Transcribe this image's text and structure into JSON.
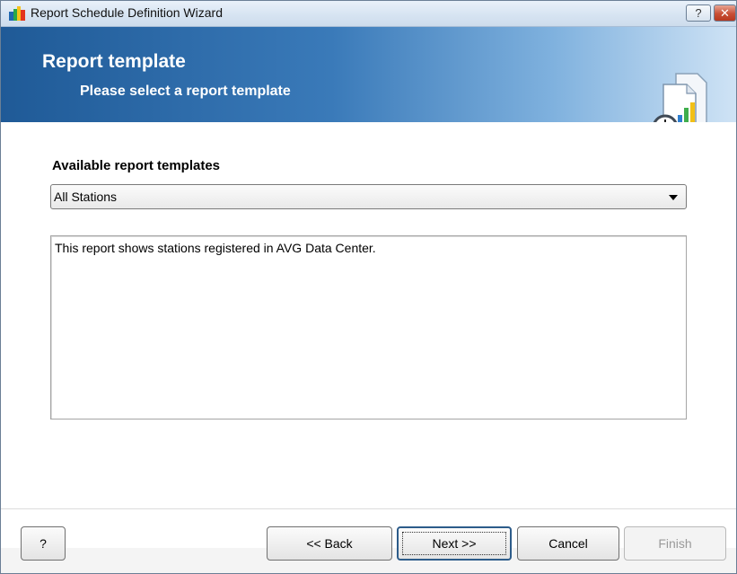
{
  "window": {
    "title": "Report Schedule Definition Wizard",
    "help_label": "?",
    "close_label": "✕"
  },
  "header": {
    "title": "Report template",
    "subtitle": "Please select a report template"
  },
  "form": {
    "templates_label": "Available report templates",
    "selected_template": "All Stations",
    "description": "This report shows stations registered in AVG Data Center."
  },
  "buttons": {
    "help": "?",
    "back": "<< Back",
    "next": "Next >>",
    "cancel": "Cancel",
    "finish": "Finish"
  },
  "colors": {
    "banner_dark": "#1f5a97",
    "banner_light": "#cfe3f5",
    "disabled_text": "#9a9a9a"
  },
  "icons": {
    "app": "avg-logo-icon",
    "header": "report-schedule-icon"
  }
}
